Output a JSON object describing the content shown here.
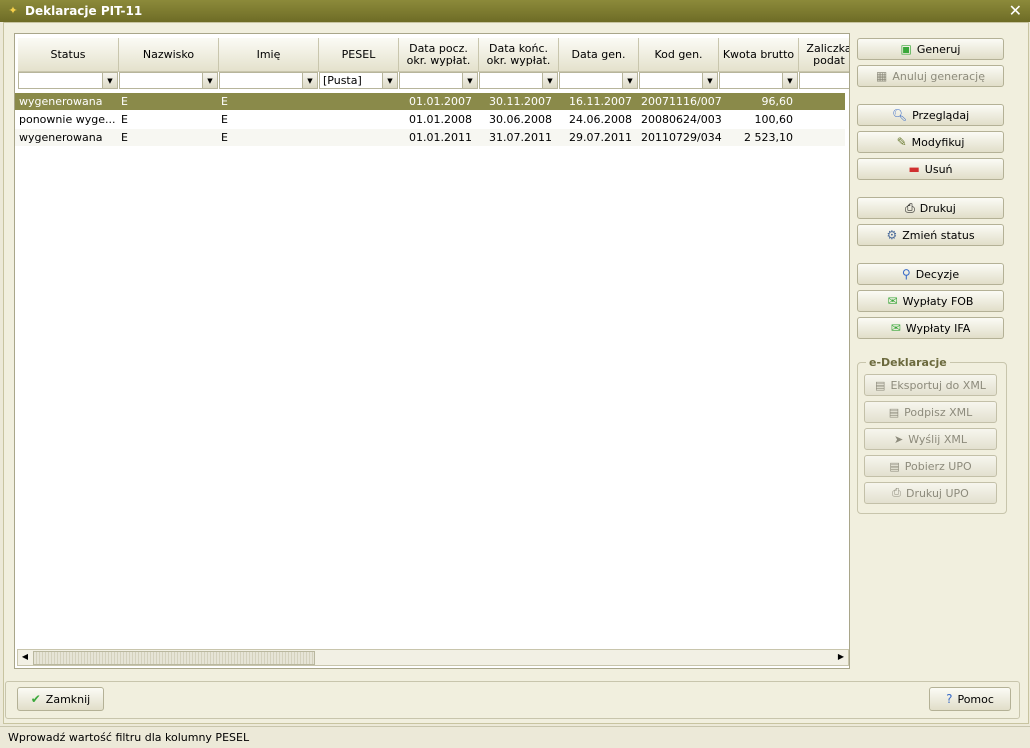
{
  "window": {
    "title": "Deklaracje PIT-11"
  },
  "grid": {
    "columns": [
      "Status",
      "Nazwisko",
      "Imię",
      "PESEL",
      "Data pocz.\nokr. wypłat.",
      "Data końc.\nokr. wypłat.",
      "Data gen.",
      "Kod gen.",
      "Kwota brutto",
      "Zaliczka\npodat"
    ],
    "filters": [
      "",
      "",
      "",
      "[Pusta]",
      "",
      "",
      "",
      "",
      "",
      ""
    ],
    "rows": [
      [
        "wygenerowana",
        "E",
        "E",
        "",
        "01.01.2007",
        "30.11.2007",
        "16.11.2007",
        "20071116/007",
        "96,60",
        ""
      ],
      [
        "ponownie wyge...",
        "E",
        "E",
        "",
        "01.01.2008",
        "30.06.2008",
        "24.06.2008",
        "20080624/003",
        "100,60",
        ""
      ],
      [
        "wygenerowana",
        "E",
        "E",
        "",
        "01.01.2011",
        "31.07.2011",
        "29.07.2011",
        "20110729/034",
        "2 523,10",
        ""
      ]
    ]
  },
  "actions": {
    "generuj": "Generuj",
    "anuluj": "Anuluj generację",
    "przegladaj": "Przeglądaj",
    "modyfikuj": "Modyfikuj",
    "usun": "Usuń",
    "drukuj": "Drukuj",
    "zmien_status": "Zmień status",
    "decyzje": "Decyzje",
    "wyplaty_fob": "Wypłaty FOB",
    "wyplaty_ifa": "Wypłaty IFA"
  },
  "edeklaracje": {
    "title": "e-Deklaracje",
    "eksportuj": "Eksportuj do XML",
    "podpisz": "Podpisz XML",
    "wyslij": "Wyślij XML",
    "pobierz": "Pobierz UPO",
    "drukuj_upo": "Drukuj UPO"
  },
  "footer": {
    "zamknij": "Zamknij",
    "pomoc": "Pomoc"
  },
  "status": {
    "text": "Wprowadź wartość filtru dla kolumny PESEL"
  },
  "colors": {
    "title_bar": "#7d7b30",
    "selected_row": "#8a8a4a",
    "accent_green": "#3aa83a"
  }
}
